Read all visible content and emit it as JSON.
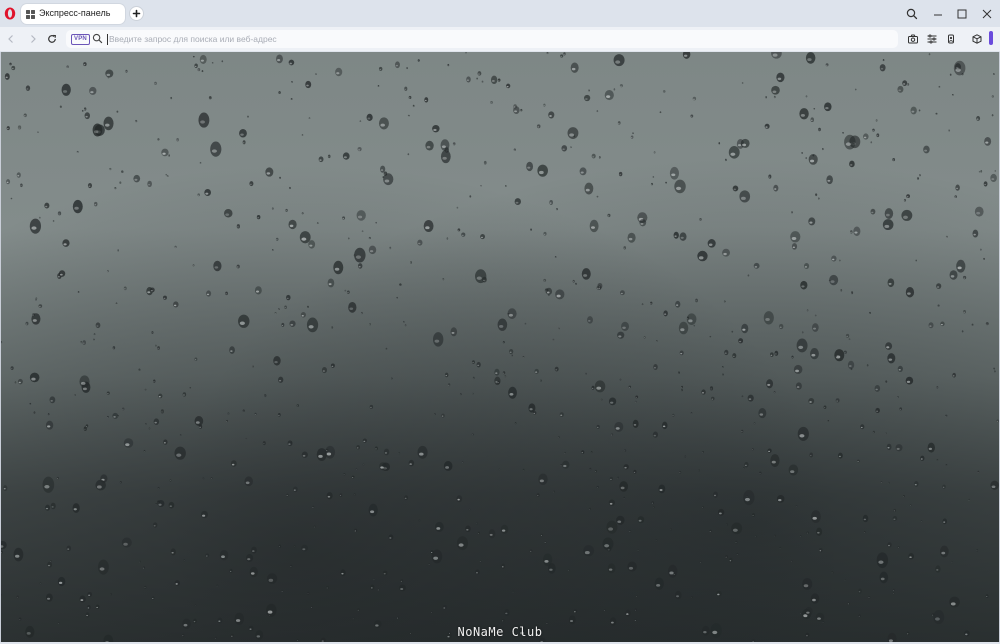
{
  "window": {
    "tab_title": "Экспресс-панель"
  },
  "addressbar": {
    "vpn_label": "VPN",
    "placeholder": "Введите запрос для поиска или веб-адрес",
    "value": ""
  },
  "icons": {
    "opera_logo": "opera-logo-icon",
    "speed_dial": "speed-dial-grid-icon",
    "new_tab": "plus-icon",
    "window_search": "search-icon",
    "minimize": "minimize-icon",
    "maximize": "maximize-icon",
    "close": "close-icon",
    "back": "back-arrow-icon",
    "forward": "forward-arrow-icon",
    "reload": "reload-icon",
    "addr_search": "search-icon",
    "snapshot": "camera-icon",
    "easy_setup": "sliders-icon",
    "account": "account-icon",
    "extensions": "cube-icon"
  },
  "colors": {
    "accent": "#6a4bdc",
    "opera_red": "#e0142c",
    "vpn": "#6b55b8"
  },
  "background": {
    "watermark": "NoNaMe Club"
  }
}
